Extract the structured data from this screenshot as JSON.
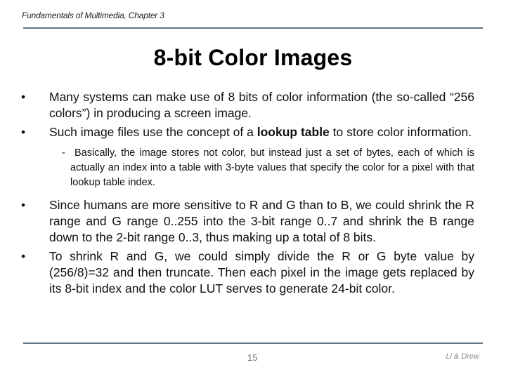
{
  "header": {
    "course_title": "Fundamentals of Multimedia, Chapter 3"
  },
  "slide": {
    "title": "8-bit Color Images",
    "bullets": [
      {
        "text": "Many systems can make use of 8 bits of color information (the so-called “256 colors”) in producing a screen image."
      },
      {
        "text_before": "Such image files use the concept of a ",
        "bold": "lookup table",
        "text_after": " to store color information."
      }
    ],
    "sub_bullet": {
      "marker": "-",
      "text": "Basically, the image stores not color, but instead just a set of bytes, each of which is actually an index into a table with 3-byte values that specify the color for a pixel with that lookup table index."
    },
    "bullets_after": [
      {
        "text": "Since humans are more sensitive to R and G than to B, we could shrink the R range and G range 0..255 into the 3-bit range 0..7 and shrink the B range down to the 2-bit range 0..3, thus making up a total of 8 bits."
      },
      {
        "text": "To shrink R and G, we could simply divide the R or G byte value by (256/8)=32 and then truncate. Then each pixel in the image gets replaced by its 8-bit index and the color LUT serves to generate 24-bit color."
      }
    ],
    "bullet_marker": "•"
  },
  "footer": {
    "page_number": "15",
    "authors": "Li & Drew"
  },
  "colors": {
    "rule": "#5e7787",
    "text": "#111111"
  }
}
